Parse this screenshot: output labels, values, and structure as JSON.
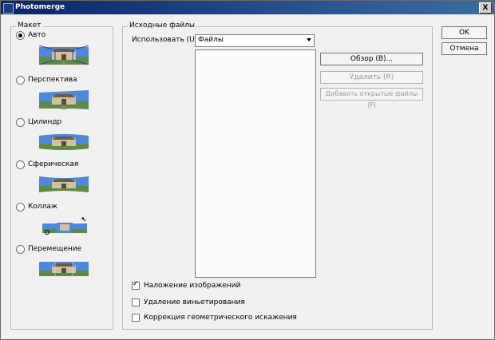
{
  "window": {
    "title": "Photomerge",
    "close_label": "X"
  },
  "layout": {
    "legend": "Макет",
    "options": [
      {
        "label": "Авто",
        "checked": true,
        "thumb": "auto"
      },
      {
        "label": "Перспектива",
        "checked": false,
        "thumb": "perspective"
      },
      {
        "label": "Цилиндр",
        "checked": false,
        "thumb": "cylinder"
      },
      {
        "label": "Сферическая",
        "checked": false,
        "thumb": "spherical"
      },
      {
        "label": "Коллаж",
        "checked": false,
        "thumb": "collage"
      },
      {
        "label": "Перемещение",
        "checked": false,
        "thumb": "reposition"
      }
    ]
  },
  "source": {
    "legend": "Исходные файлы",
    "use_label": "Использовать (U):",
    "use_value": "Файлы",
    "browse_label": "Обзор (B)...",
    "remove_label": "Удалить (R)",
    "add_open_label": "Добавить открытые файлы (F)"
  },
  "options": [
    {
      "label": "Наложение изображений",
      "checked": true
    },
    {
      "label": "Удаление виньетирования",
      "checked": false
    },
    {
      "label": "Коррекция геометрического искажения",
      "checked": false
    }
  ],
  "buttons": {
    "ok": "OK",
    "cancel": "Отмена"
  }
}
